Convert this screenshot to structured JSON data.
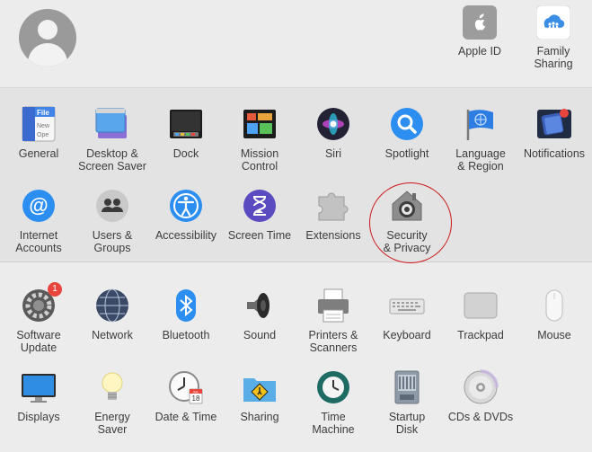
{
  "top": {
    "apple_id": "Apple ID",
    "family_sharing": "Family\nSharing"
  },
  "row1": [
    {
      "name": "general",
      "label": "General",
      "icon": "general-icon"
    },
    {
      "name": "desktop-screen-saver",
      "label": "Desktop &\nScreen Saver",
      "icon": "desktop-icon"
    },
    {
      "name": "dock",
      "label": "Dock",
      "icon": "dock-icon"
    },
    {
      "name": "mission-control",
      "label": "Mission\nControl",
      "icon": "mission-control-icon"
    },
    {
      "name": "siri",
      "label": "Siri",
      "icon": "siri-icon"
    },
    {
      "name": "spotlight",
      "label": "Spotlight",
      "icon": "spotlight-icon"
    },
    {
      "name": "language-region",
      "label": "Language\n& Region",
      "icon": "flag-icon"
    },
    {
      "name": "notifications",
      "label": "Notifications",
      "icon": "notifications-icon"
    }
  ],
  "row2": [
    {
      "name": "internet-accounts",
      "label": "Internet\nAccounts",
      "icon": "at-icon"
    },
    {
      "name": "users-groups",
      "label": "Users &\nGroups",
      "icon": "users-icon"
    },
    {
      "name": "accessibility",
      "label": "Accessibility",
      "icon": "accessibility-icon"
    },
    {
      "name": "screen-time",
      "label": "Screen Time",
      "icon": "hourglass-icon"
    },
    {
      "name": "extensions",
      "label": "Extensions",
      "icon": "puzzle-icon"
    },
    {
      "name": "security-privacy",
      "label": "Security\n& Privacy",
      "icon": "house-lock-icon"
    }
  ],
  "row3": [
    {
      "name": "software-update",
      "label": "Software\nUpdate",
      "icon": "gear-icon",
      "badge": "1"
    },
    {
      "name": "network",
      "label": "Network",
      "icon": "globe-icon"
    },
    {
      "name": "bluetooth",
      "label": "Bluetooth",
      "icon": "bluetooth-icon"
    },
    {
      "name": "sound",
      "label": "Sound",
      "icon": "speaker-icon"
    },
    {
      "name": "printers-scanners",
      "label": "Printers &\nScanners",
      "icon": "printer-icon"
    },
    {
      "name": "keyboard",
      "label": "Keyboard",
      "icon": "keyboard-icon"
    },
    {
      "name": "trackpad",
      "label": "Trackpad",
      "icon": "trackpad-icon"
    },
    {
      "name": "mouse",
      "label": "Mouse",
      "icon": "mouse-icon"
    }
  ],
  "row4": [
    {
      "name": "displays",
      "label": "Displays",
      "icon": "display-icon"
    },
    {
      "name": "energy-saver",
      "label": "Energy\nSaver",
      "icon": "lightbulb-icon"
    },
    {
      "name": "date-time",
      "label": "Date & Time",
      "icon": "clock-icon",
      "calendar_month": "JUL",
      "calendar_day": "18"
    },
    {
      "name": "sharing",
      "label": "Sharing",
      "icon": "sharing-folder-icon"
    },
    {
      "name": "time-machine",
      "label": "Time\nMachine",
      "icon": "time-machine-icon"
    },
    {
      "name": "startup-disk",
      "label": "Startup\nDisk",
      "icon": "disk-icon"
    },
    {
      "name": "cds-dvds",
      "label": "CDs & DVDs",
      "icon": "cd-icon"
    }
  ]
}
